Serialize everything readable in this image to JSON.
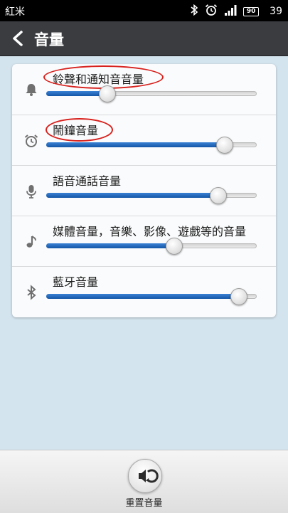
{
  "status_bar": {
    "carrier": "紅米",
    "battery": "90",
    "time": "39",
    "icons": [
      "bluetooth-icon",
      "alarm-icon",
      "signal-icon",
      "battery-icon"
    ]
  },
  "header": {
    "title": "音量",
    "back_icon": "back-arrow-icon"
  },
  "volume_rows": [
    {
      "label": "鈴聲和通知音音量",
      "icon": "bell-icon",
      "level": 0.29,
      "highlighted": true
    },
    {
      "label": "鬧鐘音量",
      "icon": "alarm-clock-icon",
      "level": 0.85,
      "highlighted": true
    },
    {
      "label": "語音通話音量",
      "icon": "microphone-icon",
      "level": 0.82,
      "highlighted": false
    },
    {
      "label": "媒體音量，音樂、影像、遊戲等的音量",
      "icon": "music-note-icon",
      "level": 0.61,
      "highlighted": false
    },
    {
      "label": "藍牙音量",
      "icon": "bluetooth-icon",
      "level": 0.92,
      "highlighted": false
    }
  ],
  "bottom_bar": {
    "reset_label": "重置音量",
    "reset_icon": "reset-volume-icon"
  },
  "colors": {
    "header_bg": "#3a3c40",
    "page_bg": "#d4e4ee",
    "slider_fill": "#1f6cc4",
    "annotation": "#d8201c"
  }
}
